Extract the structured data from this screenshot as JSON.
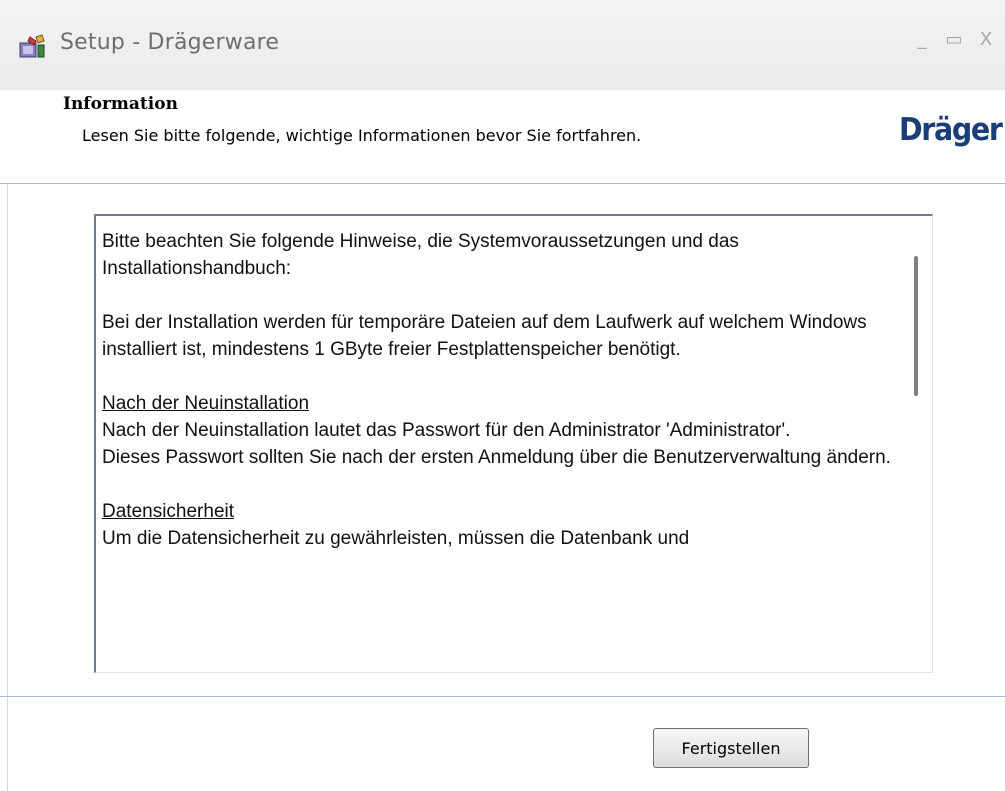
{
  "window": {
    "title": "Setup - Drägerware",
    "icon": "setup-app-icon",
    "controls": {
      "minimize": "_",
      "maximize": "▭",
      "close": "X"
    }
  },
  "header": {
    "title": "Information",
    "subtitle": "Lesen Sie bitte folgende, wichtige Informationen bevor Sie fortfahren.",
    "logo": "Dräger"
  },
  "info": {
    "paragraph1": "Bitte beachten Sie folgende Hinweise, die Systemvoraussetzungen und das Installationshandbuch:",
    "paragraph2": "Bei der Installation werden für temporäre Dateien auf dem Laufwerk auf welchem Windows installiert ist, mindestens 1 GByte freier Festplattenspeicher benötigt.",
    "section1_heading": "Nach der Neuinstallation",
    "section1_line1": "Nach der Neuinstallation lautet das Passwort für den Administrator 'Administrator'.",
    "section1_line2": "Dieses Passwort sollten Sie nach der ersten Anmeldung über die Benutzerverwaltung ändern.",
    "section2_heading": "Datensicherheit",
    "section2_line1": "Um die Datensicherheit zu gewährleisten, müssen die Datenbank und",
    "scroll_position": 0
  },
  "footer": {
    "finish_label": "Fertigstellen"
  },
  "colors": {
    "logo": "#1a3e7a",
    "divider": "#a7b6d6"
  }
}
